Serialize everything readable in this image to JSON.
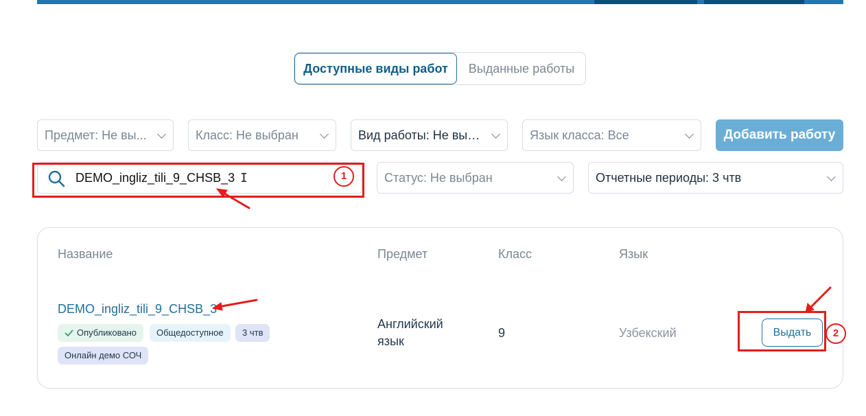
{
  "tabs": {
    "available": "Доступные виды работ",
    "issued": "Выданные работы"
  },
  "filters": {
    "subject": "Предмет: Не вы...",
    "class": "Класс: Не выбран",
    "work_type": "Вид работы: Не выб...",
    "class_language": "Язык класса: Все",
    "status": "Статус: Не выбран",
    "periods": "Отчетные периоды: 3 чтв"
  },
  "add_button": "Добавить работу",
  "search": {
    "value": "DEMO_ingliz_tili_9_CHSB_3"
  },
  "table": {
    "headers": {
      "name": "Название",
      "subject": "Предмет",
      "class": "Класс",
      "language": "Язык"
    },
    "rows": [
      {
        "name": "DEMO_ingliz_tili_9_CHSB_3",
        "tags": {
          "published": "Опубликовано",
          "public": "Общедоступное",
          "period": "3 чтв",
          "online": "Онлайн демо СОЧ"
        },
        "subject_line1": "Английский",
        "subject_line2": "язык",
        "class": "9",
        "language": "Узбекский",
        "action": "Выдать"
      }
    ]
  },
  "annotations": {
    "step1": "1",
    "step2": "2"
  },
  "colors": {
    "accent": "#1f6f9a",
    "annotation_red": "#e41c1c",
    "add_button_bg": "#6aaed6"
  }
}
